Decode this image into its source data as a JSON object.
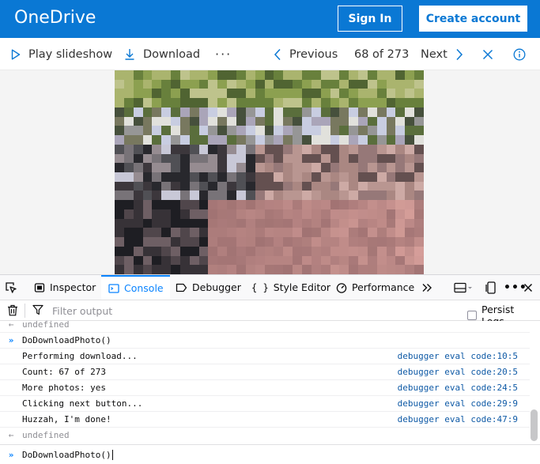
{
  "header": {
    "brand": "OneDrive",
    "sign_in_label": "Sign In",
    "create_account_label": "Create account",
    "bg_color": "#0a78d4"
  },
  "commandbar": {
    "play_slideshow": "Play slideshow",
    "download": "Download",
    "more": "···",
    "previous": "Previous",
    "position": "68 of 273",
    "next": "Next"
  },
  "devtools": {
    "tabs": {
      "inspector": "Inspector",
      "console": "Console",
      "debugger": "Debugger",
      "style_editor": "Style Editor",
      "performance": "Performance"
    },
    "active_tab": "Console",
    "filter_placeholder": "Filter output",
    "persist_logs_label": "Persist Logs",
    "persist_logs_checked": false,
    "accent_color": "#0a84ff"
  },
  "console": {
    "lines": [
      {
        "kind": "result",
        "text": "undefined",
        "source": ""
      },
      {
        "kind": "input",
        "text": "DoDownloadPhoto()",
        "source": ""
      },
      {
        "kind": "log",
        "text": "Performing download...",
        "source": "debugger eval code:10:5"
      },
      {
        "kind": "log",
        "text": "Count: 67 of 273",
        "source": "debugger eval code:20:5"
      },
      {
        "kind": "log",
        "text": "More photos: yes",
        "source": "debugger eval code:24:5"
      },
      {
        "kind": "log",
        "text": "Clicking next button...",
        "source": "debugger eval code:29:9"
      },
      {
        "kind": "log",
        "text": "Huzzah, I'm done!",
        "source": "debugger eval code:47:9"
      },
      {
        "kind": "result",
        "text": "undefined",
        "source": ""
      }
    ],
    "input_value": "DoDownloadPhoto()"
  }
}
